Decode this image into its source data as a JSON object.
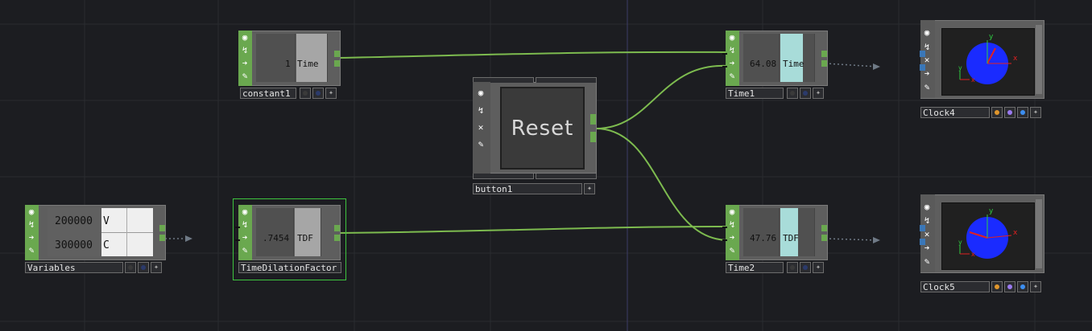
{
  "app": "node network editor",
  "nodes": {
    "constant1": {
      "name": "constant1",
      "value": "1",
      "channel": "Time"
    },
    "time1": {
      "name": "Time1",
      "value": "64.08",
      "channel": "Time"
    },
    "time2": {
      "name": "Time2",
      "value": "47.76",
      "channel": "TDF"
    },
    "clock4": {
      "name": "Clock4"
    },
    "clock5": {
      "name": "Clock5"
    },
    "button1": {
      "name": "button1",
      "button_label": "Reset"
    },
    "variables": {
      "name": "Variables",
      "rows": [
        {
          "value": "200000",
          "label": "V"
        },
        {
          "value": "300000",
          "label": "C"
        }
      ]
    },
    "tdf": {
      "name": "TimeDilationFactor",
      "value": ".7454",
      "channel": "TDF"
    }
  },
  "colors": {
    "background": "#1c1d21",
    "operator_green": "#6aa84f",
    "wire_green": "#7dbb4f",
    "selection_green": "#3ec43e",
    "clock_face_blue": "#1a2bff",
    "clock_hand_red": "#e02020",
    "time_bar_cyan": "#a8dcd9"
  },
  "clock_axis_labels": {
    "x": "x",
    "y": "y"
  },
  "icons": [
    "viewer-icon",
    "cook-icon",
    "bypass-icon",
    "export-icon",
    "lock-icon",
    "wire-icon"
  ]
}
